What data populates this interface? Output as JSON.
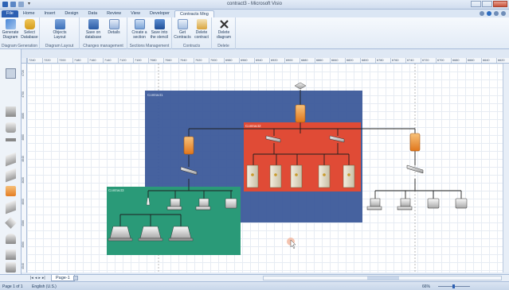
{
  "window": {
    "title": "contract3 - Microsoft Visio"
  },
  "tabs": [
    {
      "label": "File"
    },
    {
      "label": "Home"
    },
    {
      "label": "Insert"
    },
    {
      "label": "Design"
    },
    {
      "label": "Data"
    },
    {
      "label": "Review"
    },
    {
      "label": "View"
    },
    {
      "label": "Developer"
    },
    {
      "label": "Contracts Mng"
    }
  ],
  "ribbon": {
    "groups": [
      {
        "label": "Diagram Generation",
        "buttons": [
          {
            "label": "Generate Diagram",
            "icon": "generate-icon"
          },
          {
            "label": "Select Database",
            "icon": "database-icon"
          }
        ]
      },
      {
        "label": "Diagram Layout",
        "buttons": [
          {
            "label": "Objects Layout",
            "icon": "layout-icon"
          }
        ]
      },
      {
        "label": "Changes management",
        "buttons": [
          {
            "label": "Save on database",
            "icon": "save-db-icon"
          },
          {
            "label": "Details",
            "icon": "details-icon"
          }
        ]
      },
      {
        "label": "Sections Management",
        "buttons": [
          {
            "label": "Create a section",
            "icon": "section-icon"
          },
          {
            "label": "Save into the stencil",
            "icon": "stencil-icon"
          }
        ]
      },
      {
        "label": "Contracts",
        "buttons": [
          {
            "label": "Get Contracts",
            "icon": "get-contracts-icon"
          },
          {
            "label": "Delete contract",
            "icon": "delete-contract-icon"
          }
        ]
      },
      {
        "label": "Delete",
        "buttons": [
          {
            "label": "Delete diagram",
            "icon": "delete-diagram-icon"
          }
        ]
      }
    ]
  },
  "ruler": {
    "ticks": [
      "7240",
      "7220",
      "7200",
      "7180",
      "7160",
      "7140",
      "7120",
      "7100",
      "7080",
      "7060",
      "7040",
      "7020",
      "7000",
      "6980",
      "6960",
      "6940",
      "6920",
      "6900",
      "6880",
      "6860",
      "6840",
      "6820",
      "6800",
      "6780",
      "6760",
      "6740",
      "6720",
      "6700",
      "6680",
      "6660",
      "6640",
      "6620"
    ]
  },
  "vruler": {
    "ticks": [
      "4720",
      "4700",
      "4680",
      "4660",
      "4640",
      "4620",
      "4600",
      "4580",
      "4560",
      "4540"
    ]
  },
  "containers": [
    {
      "label": "Contract1",
      "color": "#3c5a9a"
    },
    {
      "label": "Contract2",
      "color": "#e04b36"
    },
    {
      "label": "Contract3",
      "color": "#2a9a78"
    }
  ],
  "pages": {
    "tab_label": "Page-1"
  },
  "status": {
    "page": "Page 1 of 1",
    "language": "English (U.S.)",
    "zoom": "66%"
  }
}
